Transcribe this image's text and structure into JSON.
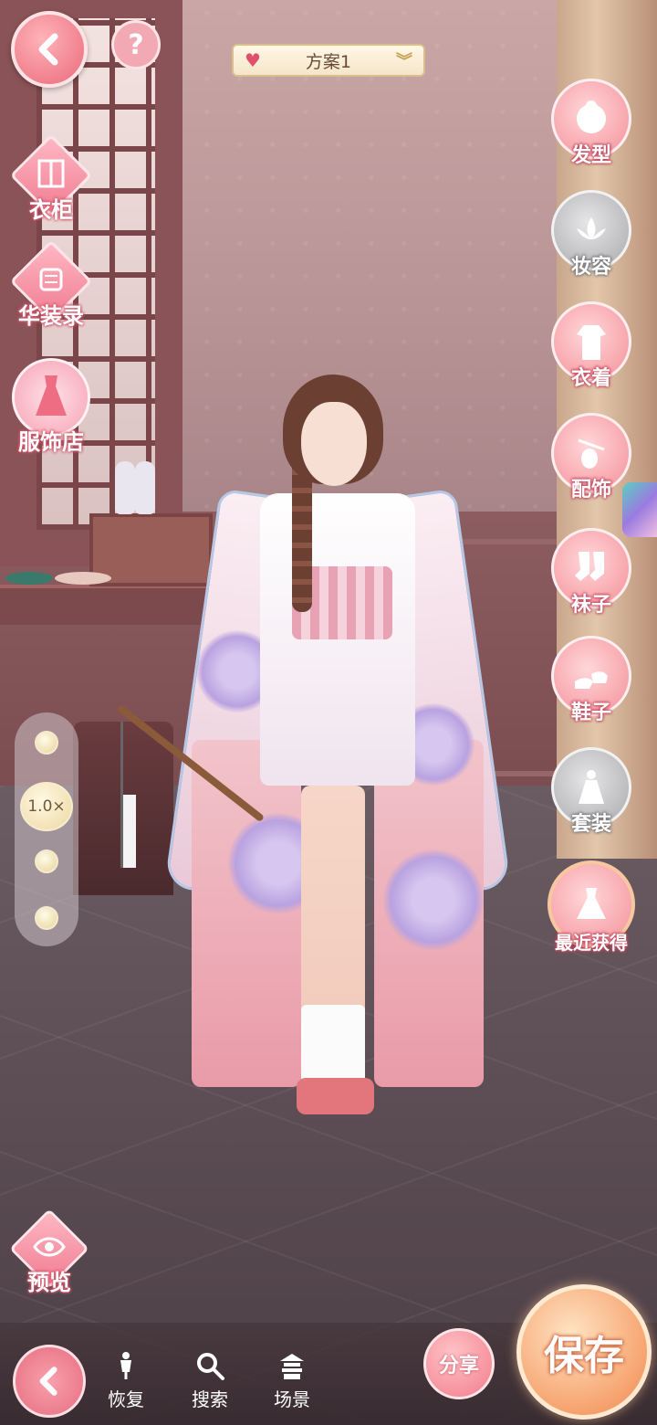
{
  "top": {
    "help_label": "?",
    "scheme_label": "方案1"
  },
  "left_menu": [
    {
      "label": "衣柜",
      "icon": "wardrobe-icon"
    },
    {
      "label": "华装录",
      "icon": "scroll-icon"
    },
    {
      "label": "服饰店",
      "icon": "dress-shop-icon"
    }
  ],
  "right_menu": [
    {
      "label": "发型",
      "icon": "hairstyle-icon",
      "active": true
    },
    {
      "label": "妆容",
      "icon": "lotus-icon",
      "active": false
    },
    {
      "label": "衣着",
      "icon": "clothing-icon",
      "active": true
    },
    {
      "label": "配饰",
      "icon": "accessory-icon",
      "active": true
    },
    {
      "label": "袜子",
      "icon": "socks-icon",
      "active": true
    },
    {
      "label": "鞋子",
      "icon": "shoes-icon",
      "active": true
    },
    {
      "label": "套装",
      "icon": "outfit-icon",
      "active": false
    },
    {
      "label": "最近获得",
      "icon": "dress-icon",
      "active": true
    }
  ],
  "zoom": {
    "level_label": "1.0×"
  },
  "preview": {
    "label": "预览"
  },
  "bottom_bar": {
    "tools": [
      {
        "label": "恢复",
        "icon": "mannequin-icon"
      },
      {
        "label": "搜索",
        "icon": "search-icon"
      },
      {
        "label": "场景",
        "icon": "pavilion-icon"
      }
    ],
    "share_label": "分享",
    "save_label": "保存"
  },
  "colors": {
    "accent_pink": "#f48f99",
    "save_orange": "#f6a36f",
    "inactive_gray": "#a9a9ad"
  }
}
